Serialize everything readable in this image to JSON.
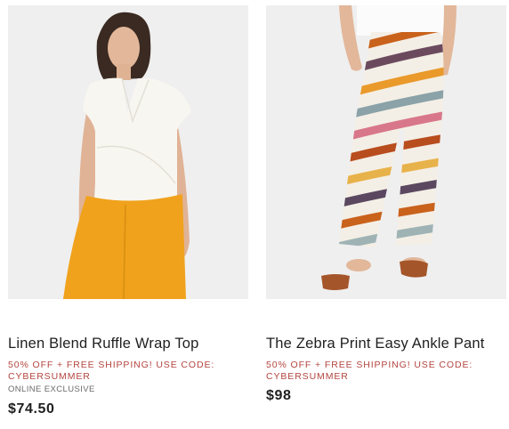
{
  "products": [
    {
      "image_alt": "linen-wrap-top-photo",
      "title": "Linen Blend Ruffle Wrap Top",
      "promo": "50% OFF + FREE SHIPPING! USE CODE: CYBERSUMMER",
      "badge": "ONLINE EXCLUSIVE",
      "price": "$74.50"
    },
    {
      "image_alt": "zebra-print-pant-photo",
      "title": "The Zebra Print Easy Ankle Pant",
      "promo": "50% OFF + FREE SHIPPING! USE CODE: CYBERSUMMER",
      "price": "$98"
    }
  ],
  "colors": {
    "promo": "#b3453f",
    "text": "#1f1f1f",
    "badge": "#6a6a6a",
    "photo_bg": "#efefef",
    "pant_yellow": "#f0a21c"
  }
}
